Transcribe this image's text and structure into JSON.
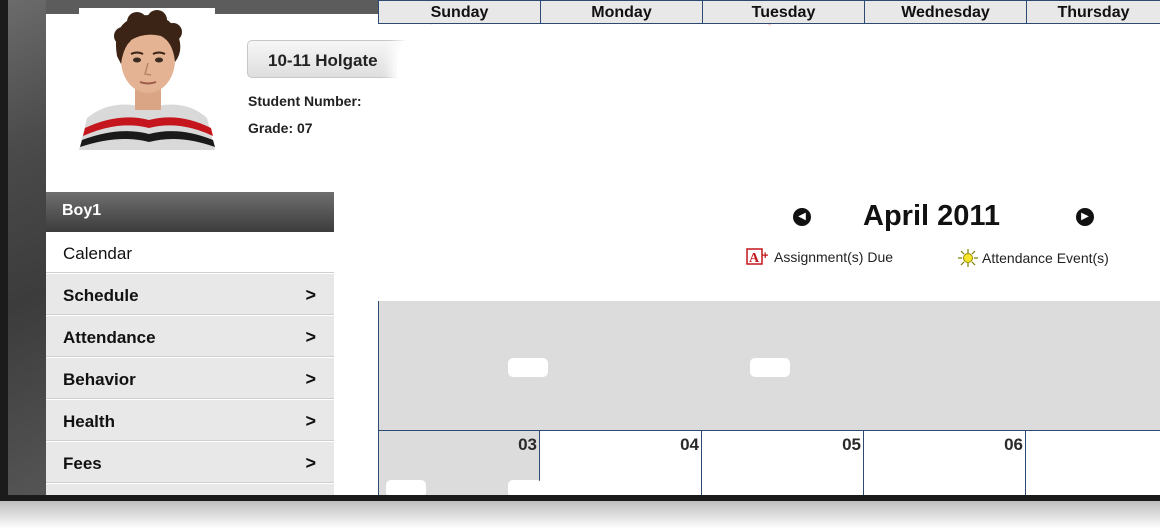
{
  "student": {
    "name_button": "10-11 Holgate",
    "number_label": "Student Number:",
    "grade_label": "Grade: 07"
  },
  "sidebar": {
    "header": "Boy1",
    "items": [
      {
        "label": "Calendar",
        "chevron": ""
      },
      {
        "label": "Schedule",
        "chevron": ">"
      },
      {
        "label": "Attendance",
        "chevron": ">"
      },
      {
        "label": "Behavior",
        "chevron": ">"
      },
      {
        "label": "Health",
        "chevron": ">"
      },
      {
        "label": "Fees",
        "chevron": ">"
      }
    ]
  },
  "calendar": {
    "month": "April 2011",
    "prev_icon": "prev-month-arrow-icon",
    "next_icon": "next-month-arrow-icon",
    "legend": {
      "assignment": "Assignment(s) Due",
      "attendance": "Attendance Event(s)"
    },
    "days": [
      "Sunday",
      "Monday",
      "Tuesday",
      "Wednesday",
      "Thursday"
    ],
    "week2_dates": [
      "03",
      "04",
      "05",
      "06",
      ""
    ]
  },
  "colors": {
    "grid_border": "#2d4a73",
    "cell_grey": "#dcdcdc",
    "sidebar_header": "#4a4a4a",
    "accent_red": "#e0201a"
  }
}
